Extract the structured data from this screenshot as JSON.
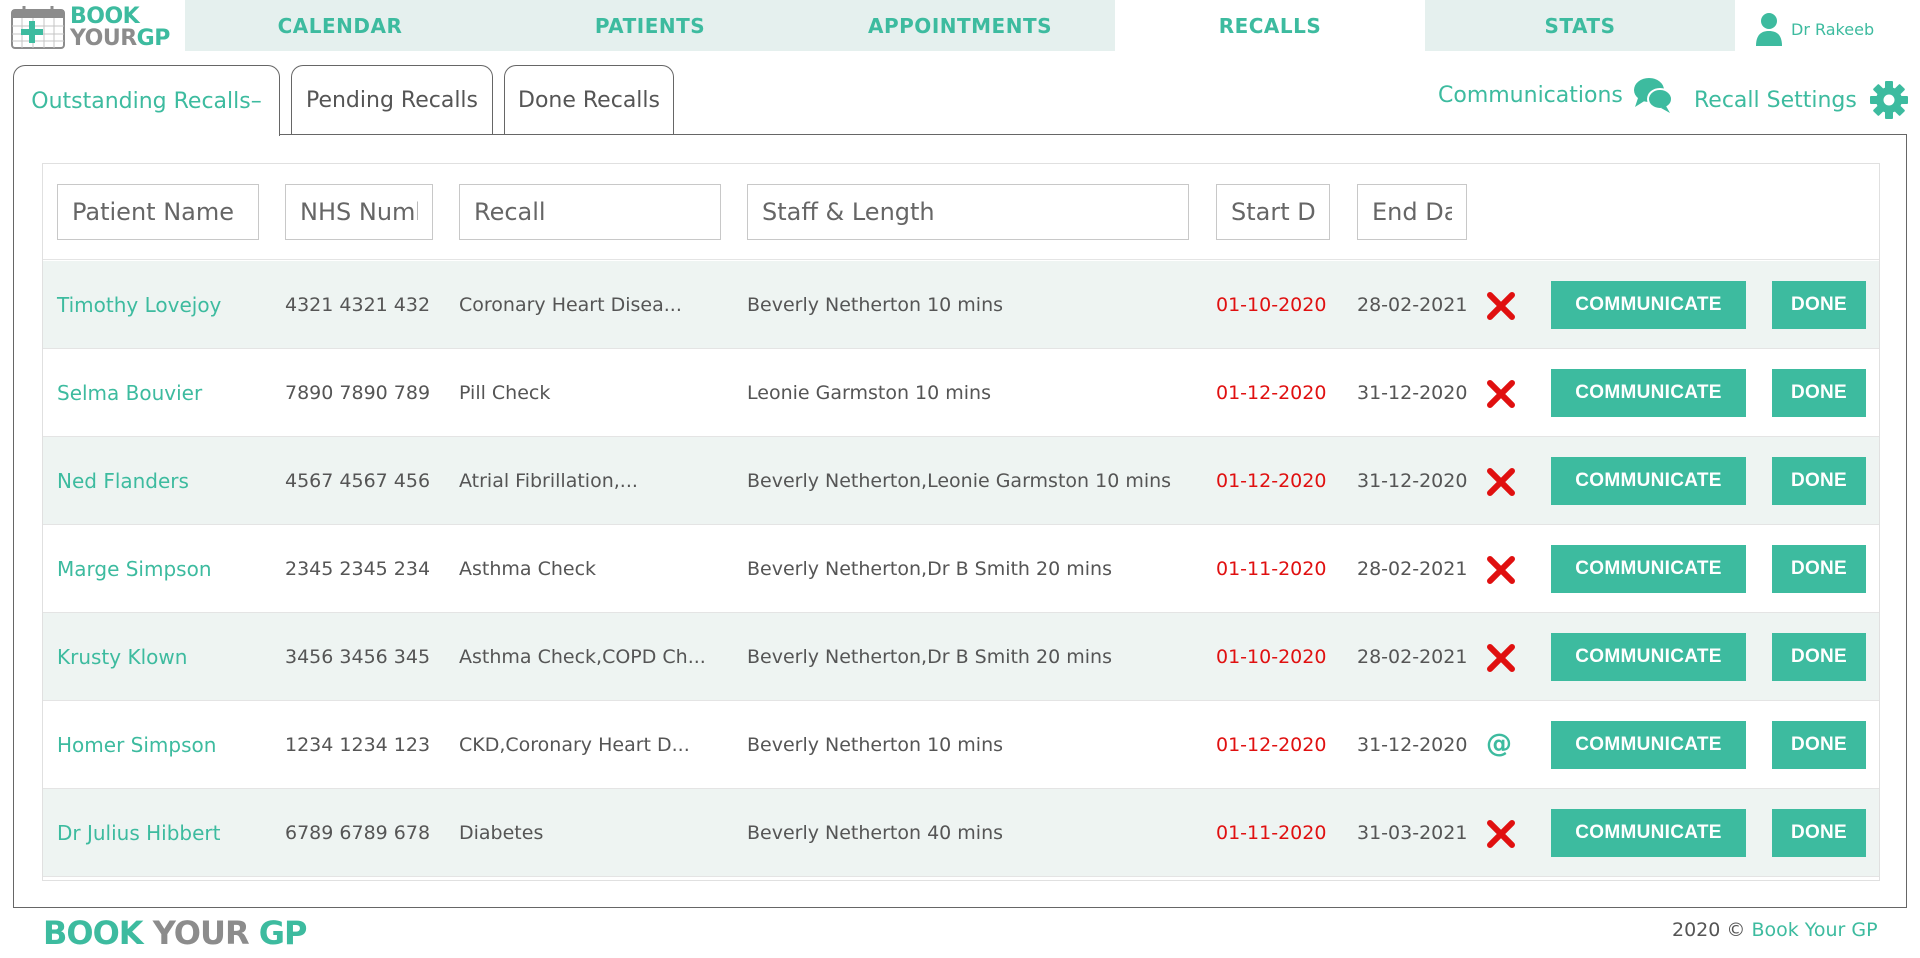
{
  "app": {
    "logo_line1": "BOOK",
    "logo_your": "YOUR",
    "logo_gp": "GP"
  },
  "nav": {
    "tabs": [
      {
        "label": "CALENDAR"
      },
      {
        "label": "PATIENTS"
      },
      {
        "label": "APPOINTMENTS"
      },
      {
        "label": "RECALLS"
      },
      {
        "label": "STATS"
      }
    ],
    "active": "RECALLS",
    "user": "Dr Rakeeb"
  },
  "subtabs": [
    {
      "label": "Outstanding Recalls–"
    },
    {
      "label": "Pending Recalls"
    },
    {
      "label": "Done Recalls"
    }
  ],
  "links": {
    "communications": "Communications",
    "recall_settings": "Recall Settings"
  },
  "filters": {
    "patient_name": "Patient Name",
    "nhs_number": "NHS Number",
    "recall": "Recall",
    "staff_length": "Staff & Length",
    "start_date": "Start Date",
    "end_date": "End Date"
  },
  "rows": [
    {
      "name": "Timothy Lovejoy",
      "nhs": "4321 4321 432",
      "recall": "Coronary Heart Disea...",
      "staff": "Beverly Netherton 10 mins",
      "start": "01-10-2020",
      "end": "28-02-2021",
      "status_icon": "cross-icon"
    },
    {
      "name": "Selma Bouvier",
      "nhs": "7890 7890 789",
      "recall": "Pill Check",
      "staff": "Leonie Garmston 10 mins",
      "start": "01-12-2020",
      "end": "31-12-2020",
      "status_icon": "cross-icon"
    },
    {
      "name": "Ned Flanders",
      "nhs": "4567 4567 456",
      "recall": "Atrial Fibrillation,...",
      "staff": "Beverly Netherton,Leonie Garmston 10 mins",
      "start": "01-12-2020",
      "end": "31-12-2020",
      "status_icon": "cross-icon"
    },
    {
      "name": "Marge Simpson",
      "nhs": "2345 2345 234",
      "recall": "Asthma Check",
      "staff": "Beverly Netherton,Dr B Smith 20 mins",
      "start": "01-11-2020",
      "end": "28-02-2021",
      "status_icon": "cross-icon"
    },
    {
      "name": "Krusty Klown",
      "nhs": "3456 3456 345",
      "recall": "Asthma Check,COPD Ch...",
      "staff": "Beverly Netherton,Dr B Smith 20 mins",
      "start": "01-10-2020",
      "end": "28-02-2021",
      "status_icon": "cross-icon"
    },
    {
      "name": "Homer Simpson",
      "nhs": "1234 1234 123",
      "recall": "CKD,Coronary Heart D...",
      "staff": "Beverly Netherton 10 mins",
      "start": "01-12-2020",
      "end": "31-12-2020",
      "status_icon": "at-icon",
      "status_text": "@"
    },
    {
      "name": "Dr Julius Hibbert",
      "nhs": "6789 6789 678",
      "recall": "Diabetes",
      "staff": "Beverly Netherton 40 mins",
      "start": "01-11-2020",
      "end": "31-03-2021",
      "status_icon": "cross-icon"
    }
  ],
  "buttons": {
    "communicate": "COMMUNICATE",
    "done": "DONE"
  },
  "footer": {
    "logo_book": "BOOK",
    "logo_your": "YOUR",
    "logo_gp": "GP",
    "copyright": "2020 ©",
    "brand_link": "Book Your GP"
  },
  "colors": {
    "accent": "#3dbb9f",
    "nav_bg": "#e5f0ee",
    "start_date": "#e01010",
    "cross": "#e01010"
  }
}
